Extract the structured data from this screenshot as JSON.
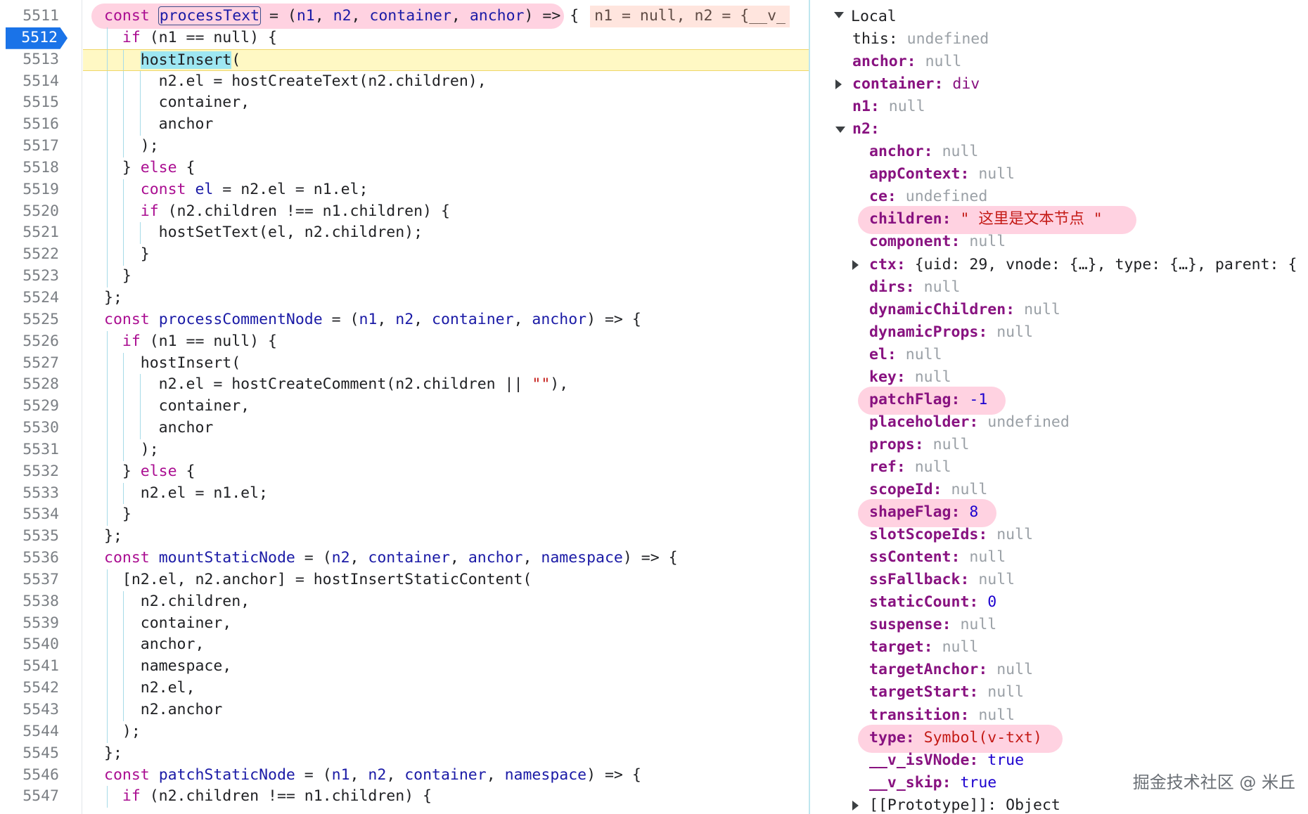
{
  "code": {
    "line_numbers": [
      "5511",
      "5512",
      "5513",
      "5514",
      "5515",
      "5516",
      "5517",
      "5518",
      "5519",
      "5520",
      "5521",
      "5522",
      "5523",
      "5524",
      "5525",
      "5526",
      "5527",
      "5528",
      "5529",
      "5530",
      "5531",
      "5532",
      "5533",
      "5534",
      "5535",
      "5536",
      "5537",
      "5538",
      "5539",
      "5540",
      "5541",
      "5542",
      "5543",
      "5544",
      "5545",
      "5546",
      "5547"
    ],
    "breakpoint_line": "5512",
    "paused_line": "5513",
    "inline_value": "n1 = null, n2 = {__v_",
    "lines": [
      "const processText = (n1, n2, container, anchor) => {",
      "  if (n1 == null) {",
      "    hostInsert(",
      "      n2.el = hostCreateText(n2.children),",
      "      container,",
      "      anchor",
      "    );",
      "  } else {",
      "    const el = n2.el = n1.el;",
      "    if (n2.children !== n1.children) {",
      "      hostSetText(el, n2.children);",
      "    }",
      "  }",
      "};",
      "const processCommentNode = (n1, n2, container, anchor) => {",
      "  if (n1 == null) {",
      "    hostInsert(",
      "      n2.el = hostCreateComment(n2.children || \"\"),",
      "      container,",
      "      anchor",
      "    );",
      "  } else {",
      "    n2.el = n1.el;",
      "  }",
      "};",
      "const mountStaticNode = (n2, container, anchor, namespace) => {",
      "  [n2.el, n2.anchor] = hostInsertStaticContent(",
      "    n2.children,",
      "    container,",
      "    anchor,",
      "    namespace,",
      "    n2.el,",
      "    n2.anchor",
      "  );",
      "};",
      "const patchStaticNode = (n1, n2, container, namespace) => {",
      "  if (n2.children !== n1.children) {"
    ]
  },
  "scope": {
    "section_label": "Local",
    "rows": [
      {
        "key": "this",
        "value": "undefined",
        "vtype": "null",
        "indent": 0,
        "arrow": ""
      },
      {
        "key": "anchor",
        "value": "null",
        "vtype": "null",
        "indent": 0,
        "arrow": ""
      },
      {
        "key": "container",
        "value": "div",
        "vtype": "tag",
        "indent": 0,
        "arrow": "right"
      },
      {
        "key": "n1",
        "value": "null",
        "vtype": "null",
        "indent": 0,
        "arrow": ""
      },
      {
        "key": "n2",
        "value": "",
        "vtype": "obj",
        "indent": 0,
        "arrow": "down"
      },
      {
        "key": "anchor",
        "value": "null",
        "vtype": "null",
        "indent": 1,
        "arrow": ""
      },
      {
        "key": "appContext",
        "value": "null",
        "vtype": "null",
        "indent": 1,
        "arrow": ""
      },
      {
        "key": "ce",
        "value": "undefined",
        "vtype": "null",
        "indent": 1,
        "arrow": ""
      },
      {
        "key": "children",
        "value": "\" 这里是文本节点 \"",
        "vtype": "str",
        "indent": 1,
        "arrow": "",
        "highlight": true
      },
      {
        "key": "component",
        "value": "null",
        "vtype": "null",
        "indent": 1,
        "arrow": ""
      },
      {
        "key": "ctx",
        "value": "{uid: 29, vnode: {…}, type: {…}, parent: {",
        "vtype": "obj",
        "indent": 1,
        "arrow": "right"
      },
      {
        "key": "dirs",
        "value": "null",
        "vtype": "null",
        "indent": 1,
        "arrow": ""
      },
      {
        "key": "dynamicChildren",
        "value": "null",
        "vtype": "null",
        "indent": 1,
        "arrow": ""
      },
      {
        "key": "dynamicProps",
        "value": "null",
        "vtype": "null",
        "indent": 1,
        "arrow": ""
      },
      {
        "key": "el",
        "value": "null",
        "vtype": "null",
        "indent": 1,
        "arrow": ""
      },
      {
        "key": "key",
        "value": "null",
        "vtype": "null",
        "indent": 1,
        "arrow": ""
      },
      {
        "key": "patchFlag",
        "value": "-1",
        "vtype": "num",
        "indent": 1,
        "arrow": "",
        "highlight": true
      },
      {
        "key": "placeholder",
        "value": "undefined",
        "vtype": "null",
        "indent": 1,
        "arrow": ""
      },
      {
        "key": "props",
        "value": "null",
        "vtype": "null",
        "indent": 1,
        "arrow": ""
      },
      {
        "key": "ref",
        "value": "null",
        "vtype": "null",
        "indent": 1,
        "arrow": ""
      },
      {
        "key": "scopeId",
        "value": "null",
        "vtype": "null",
        "indent": 1,
        "arrow": ""
      },
      {
        "key": "shapeFlag",
        "value": "8",
        "vtype": "num",
        "indent": 1,
        "arrow": "",
        "highlight": true
      },
      {
        "key": "slotScopeIds",
        "value": "null",
        "vtype": "null",
        "indent": 1,
        "arrow": ""
      },
      {
        "key": "ssContent",
        "value": "null",
        "vtype": "null",
        "indent": 1,
        "arrow": ""
      },
      {
        "key": "ssFallback",
        "value": "null",
        "vtype": "null",
        "indent": 1,
        "arrow": ""
      },
      {
        "key": "staticCount",
        "value": "0",
        "vtype": "num",
        "indent": 1,
        "arrow": ""
      },
      {
        "key": "suspense",
        "value": "null",
        "vtype": "null",
        "indent": 1,
        "arrow": ""
      },
      {
        "key": "target",
        "value": "null",
        "vtype": "null",
        "indent": 1,
        "arrow": ""
      },
      {
        "key": "targetAnchor",
        "value": "null",
        "vtype": "null",
        "indent": 1,
        "arrow": ""
      },
      {
        "key": "targetStart",
        "value": "null",
        "vtype": "null",
        "indent": 1,
        "arrow": ""
      },
      {
        "key": "transition",
        "value": "null",
        "vtype": "null",
        "indent": 1,
        "arrow": ""
      },
      {
        "key": "type",
        "value": "Symbol(v-txt)",
        "vtype": "str",
        "indent": 1,
        "arrow": "",
        "highlight": true
      },
      {
        "key": "__v_isVNode",
        "value": "true",
        "vtype": "num",
        "indent": 1,
        "arrow": ""
      },
      {
        "key": "__v_skip",
        "value": "true",
        "vtype": "num",
        "indent": 1,
        "arrow": ""
      },
      {
        "key": "[[Prototype]]",
        "value": "Object",
        "vtype": "obj",
        "indent": 1,
        "arrow": "right",
        "plainkey": true
      }
    ]
  },
  "watermark": "掘金技术社区 @ 米丘",
  "colors": {
    "breakpoint": "#1a73e8",
    "paused_line": "#fff8c4",
    "annotation_pink": "#ffd2e1",
    "keyword": "#aa0d91",
    "scope_key": "#881280"
  }
}
